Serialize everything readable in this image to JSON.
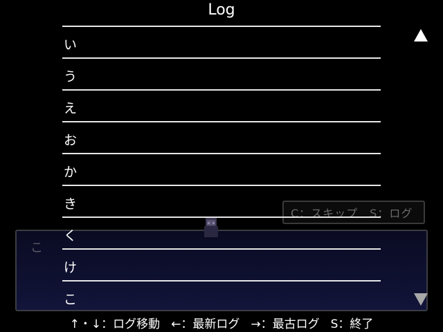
{
  "background": {
    "hint_text": "C：スキップ　S：ログ",
    "message_text": "こ"
  },
  "log": {
    "title": "Log",
    "entries": [
      "い",
      "う",
      "え",
      "お",
      "か",
      "き",
      "く",
      "け",
      "こ"
    ]
  },
  "controls": {
    "scroll_up_icon": "triangle-up-icon",
    "scroll_down_icon": "triangle-down-icon",
    "help": [
      "↑・↓：ログ移動",
      "←：最新ログ",
      "→：最古ログ",
      "S：終了"
    ]
  }
}
